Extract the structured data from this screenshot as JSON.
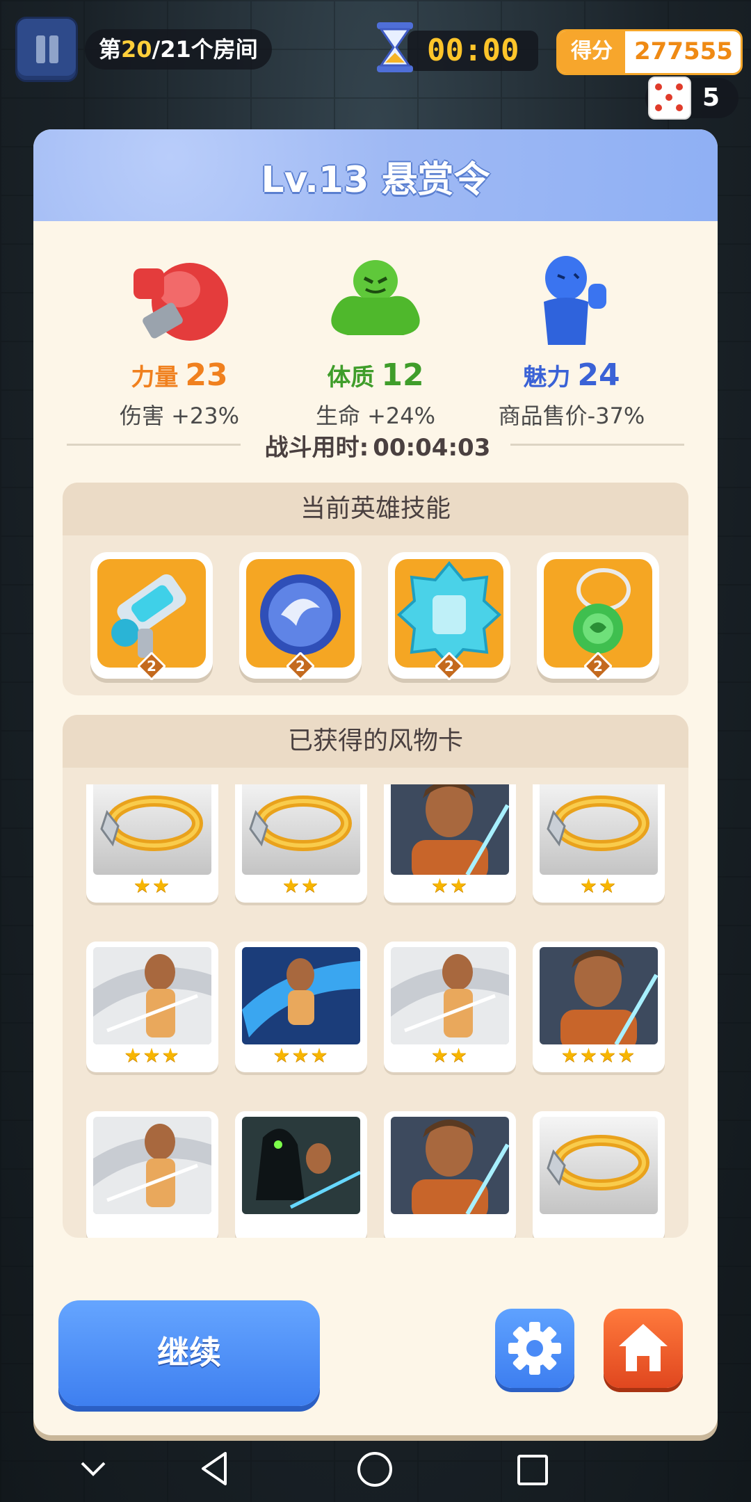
{
  "hud": {
    "room_prefix": "第",
    "room_current": "20",
    "room_total": "/21",
    "room_suffix": "个房间",
    "timer": "00:00",
    "score_label": "得分",
    "score_value": "277555",
    "dice_count": "5"
  },
  "panel": {
    "title": "Lv.13 悬赏令",
    "stats": [
      {
        "name": "力量",
        "value": "23",
        "effect": "伤害 +23%",
        "color": "#f0801e"
      },
      {
        "name": "体质",
        "value": "12",
        "effect": "生命 +24%",
        "color": "#3f9d2a"
      },
      {
        "name": "魅力",
        "value": "24",
        "effect": "商品售价-37%",
        "color": "#3a62d6"
      }
    ],
    "battle_time_label": "战斗用时:",
    "battle_time_value": "00:04:03",
    "skills_header": "当前英雄技能",
    "skills": [
      {
        "icon": "blaster-icon",
        "level": "2"
      },
      {
        "icon": "orb-icon",
        "level": "2"
      },
      {
        "icon": "ice-armor-icon",
        "level": "2"
      },
      {
        "icon": "pendant-icon",
        "level": "2"
      }
    ],
    "cards_header": "已获得的风物卡",
    "cards": [
      {
        "icon": "ring-icon",
        "stars": "★★"
      },
      {
        "icon": "ring-icon",
        "stars": "★★"
      },
      {
        "icon": "warrior-portrait-icon",
        "stars": "★★"
      },
      {
        "icon": "ring-icon",
        "stars": "★★"
      },
      {
        "icon": "warrior-slash-icon",
        "stars": "★★★"
      },
      {
        "icon": "warrior-wave-icon",
        "stars": "★★★"
      },
      {
        "icon": "warrior-slash-icon",
        "stars": "★★"
      },
      {
        "icon": "warrior-portrait-icon",
        "stars": "★★★★"
      },
      {
        "icon": "warrior-slash-icon",
        "stars": ""
      },
      {
        "icon": "shadow-clash-icon",
        "stars": ""
      },
      {
        "icon": "warrior-portrait-icon",
        "stars": ""
      },
      {
        "icon": "ring-icon",
        "stars": ""
      }
    ],
    "continue_label": "继续"
  },
  "colors": {
    "accent_blue": "#4a8af6",
    "orange": "#f7a62c",
    "home_red": "#e95427"
  }
}
